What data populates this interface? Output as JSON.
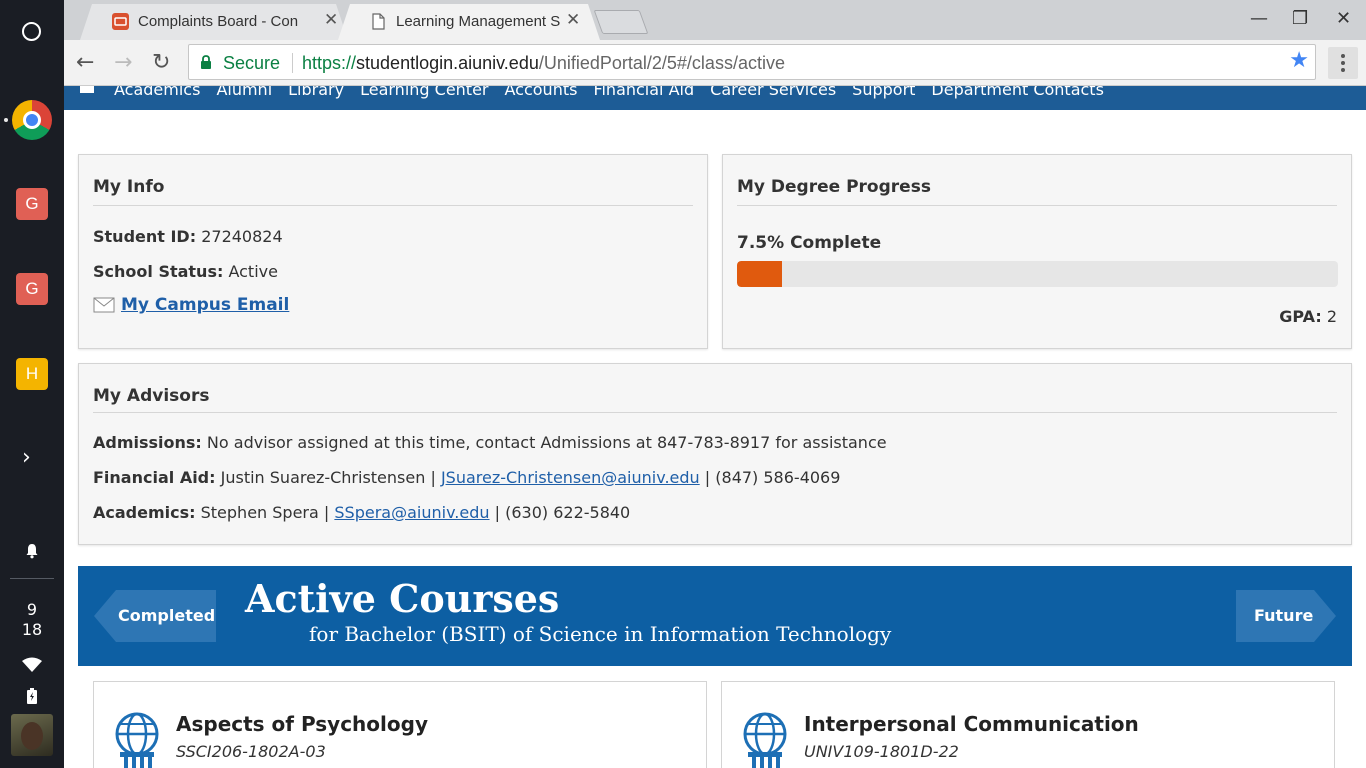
{
  "shelf": {
    "apps": [
      "G",
      "G",
      "H"
    ],
    "clock_hour": "9",
    "clock_minute": "18"
  },
  "browser": {
    "tabs": [
      {
        "title": "Complaints Board - Con",
        "favicon": "cb-favicon-icon",
        "active": false
      },
      {
        "title": "Learning Management S",
        "favicon": "page-icon",
        "active": true
      }
    ],
    "secure_label": "Secure",
    "url_scheme": "https://",
    "url_host": "studentlogin.aiuniv.edu",
    "url_path": "/UnifiedPortal/2/5#/class/active"
  },
  "site_nav": {
    "items": [
      "Academics",
      "Alumni",
      "Library",
      "Learning Center",
      "Accounts",
      "Financial Aid",
      "Career Services",
      "Support",
      "Department Contacts"
    ]
  },
  "my_info": {
    "title": "My Info",
    "student_id_label": "Student ID:",
    "student_id": "27240824",
    "status_label": "School Status:",
    "status": "Active",
    "email_link": "My Campus Email"
  },
  "degree_progress": {
    "title": "My Degree Progress",
    "percent_label": "7.5% Complete",
    "percent_value": 7.5,
    "gpa_label": "GPA:",
    "gpa": "2"
  },
  "advisors": {
    "title": "My Advisors",
    "admissions_label": "Admissions:",
    "admissions_text": "No advisor assigned at this time, contact Admissions at 847-783-8917 for assistance",
    "financial_label": "Financial Aid:",
    "financial_name": "Justin Suarez-Christensen",
    "financial_email": "JSuarez-Christensen@aiuniv.edu",
    "financial_phone": "(847) 586-4069",
    "academics_label": "Academics:",
    "academics_name": "Stephen Spera",
    "academics_email": "SSpera@aiuniv.edu",
    "academics_phone": "(630) 622-5840",
    "separator": "|"
  },
  "courses": {
    "title": "Active Courses",
    "subtitle": "for Bachelor (BSIT) of Science in Information Technology",
    "prev_label": "Completed",
    "next_label": "Future",
    "items": [
      {
        "name": "Aspects of Psychology",
        "code": "SSCI206-1802A-03"
      },
      {
        "name": "Interpersonal Communication",
        "code": "UNIV109-1801D-22"
      }
    ]
  },
  "colors": {
    "nav_blue": "#1d5c96",
    "banner_blue": "#0d5fa3",
    "progress_orange": "#e05a0e",
    "link_blue": "#1f5fa8",
    "secure_green": "#0b8043"
  }
}
